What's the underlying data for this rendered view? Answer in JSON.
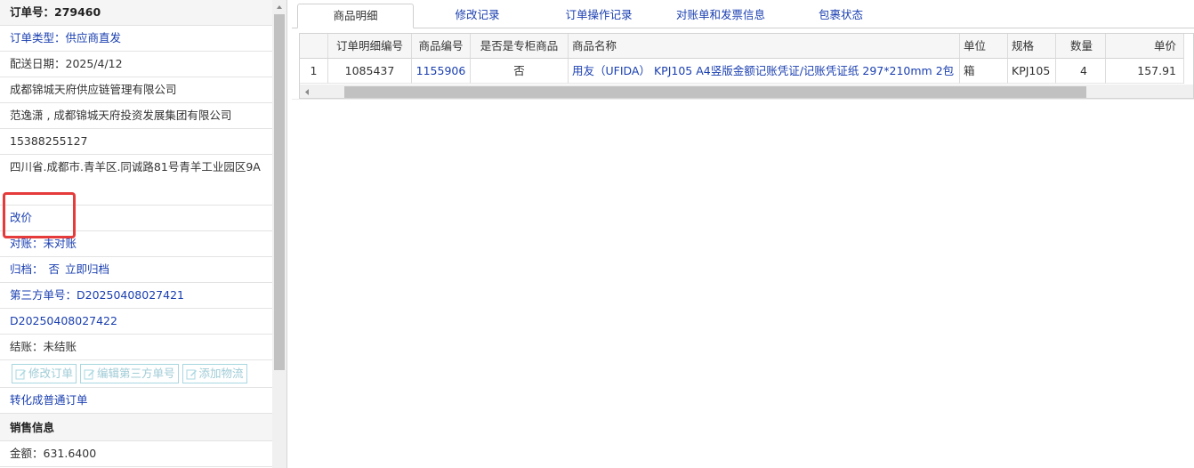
{
  "left": {
    "order_no": "订单号：279460",
    "order_type_label": "订单类型：",
    "order_type_value": "供应商直发",
    "delivery_date": "配送日期：2025/4/12",
    "company": "成都锦城天府供应链管理有限公司",
    "contact": "范逸潇 , 成都锦城天府投资发展集团有限公司",
    "phone": "15388255127",
    "address": "四川省.成都市.青羊区.同诚路81号青羊工业园区9A",
    "change_price": "改价",
    "reconcile_label": "对账：",
    "reconcile_value": "未对账",
    "archive_label": "归档：",
    "archive_value": "否",
    "archive_action": "立即归档",
    "third_party_label": "第三方单号：",
    "third_party_1": "D20250408027421",
    "third_party_2": "D20250408027422",
    "settle": "结账：未结账",
    "buttons": [
      "修改订单",
      "编辑第三方单号",
      "添加物流"
    ],
    "convert": "转化成普通订单",
    "sales_header": "销售信息",
    "amount": "金额：631.6400"
  },
  "tabs": [
    "商品明细",
    "修改记录",
    "订单操作记录",
    "对账单和发票信息",
    "包裹状态"
  ],
  "active_tab": "商品明细",
  "table": {
    "columns": [
      "",
      "订单明细编号",
      "商品编号",
      "是否是专柜商品",
      "商品名称",
      "单位",
      "规格",
      "数量",
      "单价"
    ],
    "rows": [
      [
        "1",
        "1085437",
        "1155906",
        "否",
        "用友（UFIDA） KPJ105 A4竖版金额记账凭证/记账凭证纸 297*210mm 2包",
        "箱",
        "KPJ105",
        "4",
        "157.91"
      ]
    ]
  },
  "icons": {
    "edit": "edit-icon",
    "arrow_left": "arrow-left-icon",
    "arrow_up": "arrow-up-icon"
  }
}
